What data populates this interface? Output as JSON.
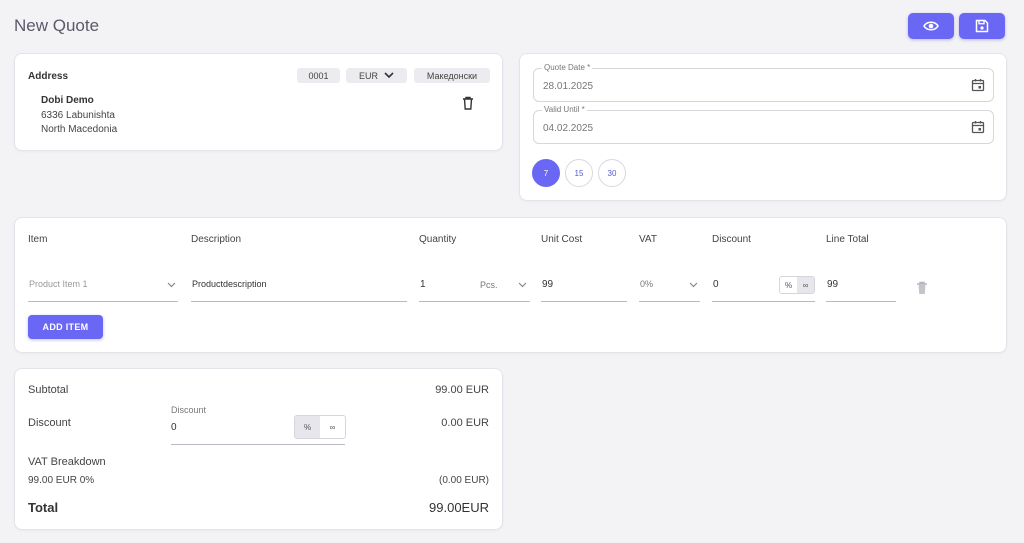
{
  "page": {
    "title": "New Quote"
  },
  "address": {
    "heading": "Address",
    "number": "0001",
    "currency": "EUR",
    "language": "Македонски",
    "name": "Dobi Demo",
    "line1": "6336 Labunishta",
    "line2": "North Macedonia"
  },
  "dates": {
    "quote_date_label": "Quote Date *",
    "quote_date_value": "28.01.2025",
    "valid_until_label": "Valid Until *",
    "valid_until_value": "04.02.2025",
    "quick_days": [
      "7",
      "15",
      "30"
    ]
  },
  "items": {
    "headers": {
      "item": "Item",
      "description": "Description",
      "quantity": "Quantity",
      "unit_cost": "Unit Cost",
      "vat": "VAT",
      "discount": "Discount",
      "line_total": "Line Total"
    },
    "row": {
      "item_placeholder": "Product Item 1",
      "description": "Productdescription",
      "quantity": "1",
      "unit": "Pcs.",
      "unit_cost": "99",
      "vat": "0%",
      "discount": "0",
      "line_total": "99"
    },
    "add_label": "ADD ITEM",
    "percent_symbol": "%",
    "amount_symbol": "∞"
  },
  "totals": {
    "subtotal_label": "Subtotal",
    "subtotal_value": "99.00 EUR",
    "discount_label": "Discount",
    "discount_field_label": "Discount",
    "discount_field_value": "0",
    "discount_value": "0.00 EUR",
    "vat_label": "VAT Breakdown",
    "vat_line_label": "99.00 EUR 0%",
    "vat_line_value": "(0.00 EUR)",
    "total_label": "Total",
    "total_value": "99.00EUR"
  },
  "colors": {
    "accent": "#6a67f5"
  }
}
